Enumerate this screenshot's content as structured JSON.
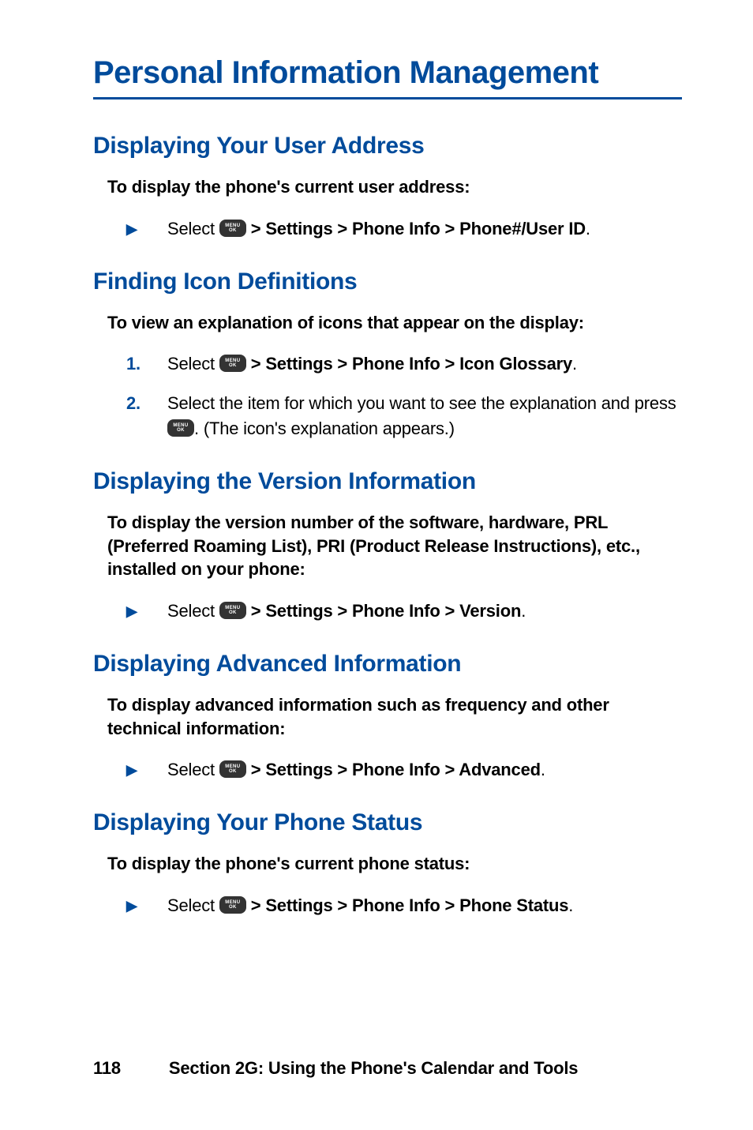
{
  "page_title": "Personal Information Management",
  "sections": [
    {
      "heading": "Displaying Your User Address",
      "intro": "To display the phone's current user address:",
      "steps": [
        {
          "marker": "▶",
          "type": "arrow",
          "pre": "Select ",
          "path": " > Settings > Phone Info > Phone#/User ID",
          "post": "."
        }
      ]
    },
    {
      "heading": "Finding Icon Definitions",
      "intro": "To view an explanation of icons that appear on the display:",
      "steps": [
        {
          "marker": "1.",
          "type": "num",
          "pre": "Select ",
          "path": " > Settings > Phone Info > Icon Glossary",
          "post": "."
        },
        {
          "marker": "2.",
          "type": "num",
          "pre2a": "Select the item for which you want to see the explanation and press ",
          "post2": ". (The icon's explanation appears.)"
        }
      ]
    },
    {
      "heading": "Displaying the Version Information",
      "intro": "To display the version number of the software, hardware, PRL (Preferred Roaming List), PRI (Product Release Instructions), etc., installed on your phone:",
      "steps": [
        {
          "marker": "▶",
          "type": "arrow",
          "pre": "Select ",
          "path": " > Settings > Phone Info > Version",
          "post": "."
        }
      ]
    },
    {
      "heading": "Displaying Advanced Information",
      "intro": "To display advanced information such as frequency and other technical information:",
      "steps": [
        {
          "marker": "▶",
          "type": "arrow",
          "pre": "Select ",
          "path": " > Settings > Phone Info > Advanced",
          "post": "."
        }
      ]
    },
    {
      "heading": "Displaying Your Phone Status",
      "intro": "To display the phone's current phone status:",
      "steps": [
        {
          "marker": "▶",
          "type": "arrow",
          "pre": "Select ",
          "path": " > Settings > Phone Info > Phone Status",
          "post": "."
        }
      ]
    }
  ],
  "menu_icon": {
    "line1": "MENU",
    "line2": "OK"
  },
  "footer": {
    "page_num": "118",
    "section": "Section 2G: Using the Phone's Calendar and Tools"
  }
}
